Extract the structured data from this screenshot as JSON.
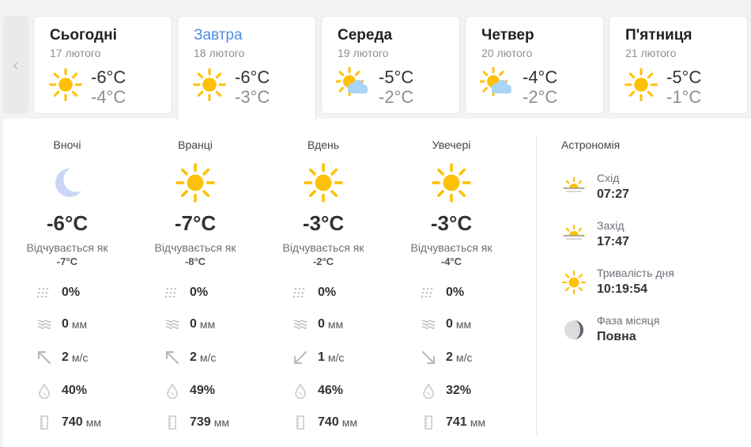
{
  "days": [
    {
      "name": "Сьогодні",
      "date": "17 лютого",
      "icon": "sun-icon",
      "tmax": "-6°C",
      "tmin": "-4°C"
    },
    {
      "name": "Завтра",
      "date": "18 лютого",
      "icon": "sun-icon",
      "tmax": "-6°C",
      "tmin": "-3°C",
      "active": true
    },
    {
      "name": "Середа",
      "date": "19 лютого",
      "icon": "sun-cloud-icon",
      "tmax": "-5°C",
      "tmin": "-2°C"
    },
    {
      "name": "Четвер",
      "date": "20 лютого",
      "icon": "sun-cloud-icon",
      "tmax": "-4°C",
      "tmin": "-2°C"
    },
    {
      "name": "П'ятниця",
      "date": "21 лютого",
      "icon": "sun-icon",
      "tmax": "-5°C",
      "tmin": "-1°C"
    }
  ],
  "periods": [
    {
      "title": "Вночі",
      "icon": "moon-icon",
      "temp": "-6°C",
      "feels_label": "Відчувається як",
      "feels": "-7°C",
      "precip_chance": "0%",
      "precip": "0",
      "precip_unit": "мм",
      "wind": "2",
      "wind_unit": "м/с",
      "wind_dir": "north-west",
      "humidity": "40%",
      "pressure": "740",
      "pressure_unit": "мм"
    },
    {
      "title": "Вранці",
      "icon": "sun-icon",
      "temp": "-7°C",
      "feels_label": "Відчувається як",
      "feels": "-8°C",
      "precip_chance": "0%",
      "precip": "0",
      "precip_unit": "мм",
      "wind": "2",
      "wind_unit": "м/с",
      "wind_dir": "north-west",
      "humidity": "49%",
      "pressure": "739",
      "pressure_unit": "мм"
    },
    {
      "title": "Вдень",
      "icon": "sun-icon",
      "temp": "-3°C",
      "feels_label": "Відчувається як",
      "feels": "-2°C",
      "precip_chance": "0%",
      "precip": "0",
      "precip_unit": "мм",
      "wind": "1",
      "wind_unit": "м/с",
      "wind_dir": "south-west",
      "humidity": "46%",
      "pressure": "740",
      "pressure_unit": "мм"
    },
    {
      "title": "Увечері",
      "icon": "sun-icon",
      "temp": "-3°C",
      "feels_label": "Відчувається як",
      "feels": "-4°C",
      "precip_chance": "0%",
      "precip": "0",
      "precip_unit": "мм",
      "wind": "2",
      "wind_unit": "м/с",
      "wind_dir": "south-east",
      "humidity": "32%",
      "pressure": "741",
      "pressure_unit": "мм"
    }
  ],
  "astronomy": {
    "title": "Астрономія",
    "items": [
      {
        "label": "Схід",
        "value": "07:27",
        "icon": "sunrise-icon"
      },
      {
        "label": "Захід",
        "value": "17:47",
        "icon": "sunset-icon"
      },
      {
        "label": "Тривалість дня",
        "value": "10:19:54",
        "icon": "sun-icon"
      },
      {
        "label": "Фаза місяця",
        "value": "Повна",
        "icon": "moon-phase-icon"
      }
    ]
  },
  "colors": {
    "sun": "#ffc107",
    "moon": "#c9d6f5",
    "cloud": "#a8d4f5",
    "accent": "#4f8ce8"
  }
}
